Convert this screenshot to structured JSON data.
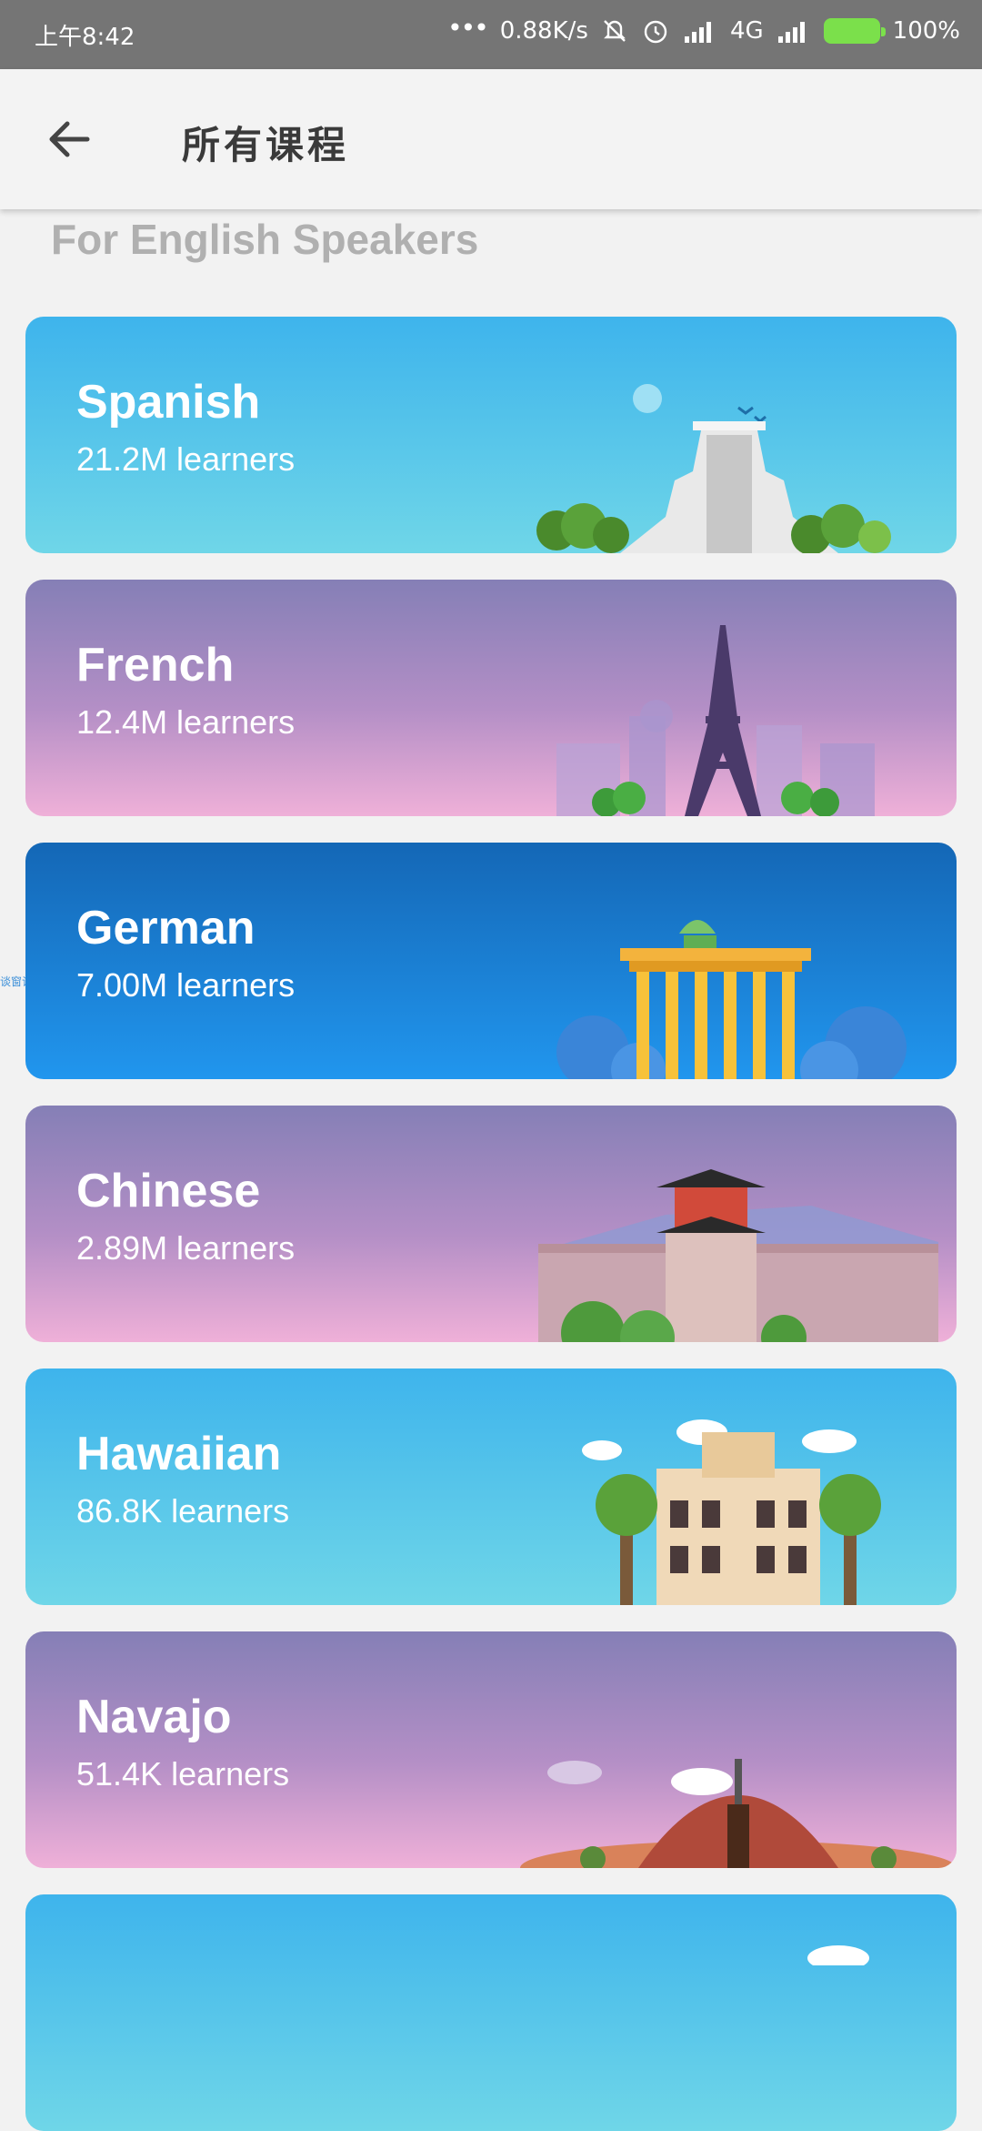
{
  "status_bar": {
    "time": "上午8:42",
    "network_speed": "0.88K/s",
    "network_type": "4G",
    "battery": "100%",
    "icons": [
      "dots-icon",
      "mute-icon",
      "alarm-icon",
      "signal-icon",
      "signal-icon",
      "battery-charging-icon"
    ]
  },
  "app_bar": {
    "back_icon": "arrow-left-icon",
    "title": "所有课程"
  },
  "section": {
    "title": "For English Speakers"
  },
  "side_label": "谈窗记录",
  "courses": [
    {
      "name": "Spanish",
      "learners": "21.2M learners",
      "theme": "blue",
      "illustration": "pyramid-icon"
    },
    {
      "name": "French",
      "learners": "12.4M learners",
      "theme": "purple",
      "illustration": "eiffel-tower-icon"
    },
    {
      "name": "German",
      "learners": "7.00M learners",
      "theme": "deepblue",
      "illustration": "brandenburg-gate-icon"
    },
    {
      "name": "Chinese",
      "learners": "2.89M learners",
      "theme": "purple",
      "illustration": "great-wall-icon"
    },
    {
      "name": "Hawaiian",
      "learners": "86.8K learners",
      "theme": "blue",
      "illustration": "palace-icon"
    },
    {
      "name": "Navajo",
      "learners": "51.4K learners",
      "theme": "purple",
      "illustration": "hogan-icon"
    },
    {
      "name": "",
      "learners": "",
      "theme": "blue",
      "illustration": "clouds-icon"
    }
  ],
  "colors": {
    "blue_top": "#3eb4ec",
    "blue_bottom": "#6fd6e8",
    "purple_top": "#857fb6",
    "purple_bottom": "#efb0d8",
    "deepblue_top": "#1467b6",
    "deepblue_bottom": "#2196ee",
    "status_bar": "#757575"
  }
}
